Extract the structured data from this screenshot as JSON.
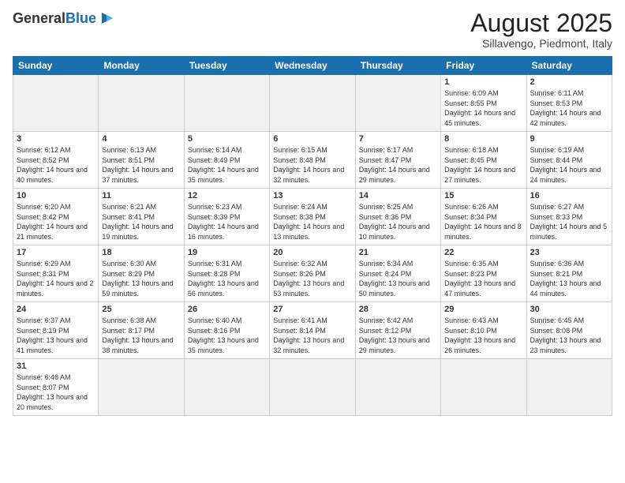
{
  "header": {
    "logo_general": "General",
    "logo_blue": "Blue",
    "title": "August 2025",
    "subtitle": "Sillavengo, Piedmont, Italy"
  },
  "days_of_week": [
    "Sunday",
    "Monday",
    "Tuesday",
    "Wednesday",
    "Thursday",
    "Friday",
    "Saturday"
  ],
  "weeks": [
    [
      {
        "day": "",
        "info": ""
      },
      {
        "day": "",
        "info": ""
      },
      {
        "day": "",
        "info": ""
      },
      {
        "day": "",
        "info": ""
      },
      {
        "day": "",
        "info": ""
      },
      {
        "day": "1",
        "info": "Sunrise: 6:09 AM\nSunset: 8:55 PM\nDaylight: 14 hours and 45 minutes."
      },
      {
        "day": "2",
        "info": "Sunrise: 6:11 AM\nSunset: 8:53 PM\nDaylight: 14 hours and 42 minutes."
      }
    ],
    [
      {
        "day": "3",
        "info": "Sunrise: 6:12 AM\nSunset: 8:52 PM\nDaylight: 14 hours and 40 minutes."
      },
      {
        "day": "4",
        "info": "Sunrise: 6:13 AM\nSunset: 8:51 PM\nDaylight: 14 hours and 37 minutes."
      },
      {
        "day": "5",
        "info": "Sunrise: 6:14 AM\nSunset: 8:49 PM\nDaylight: 14 hours and 35 minutes."
      },
      {
        "day": "6",
        "info": "Sunrise: 6:15 AM\nSunset: 8:48 PM\nDaylight: 14 hours and 32 minutes."
      },
      {
        "day": "7",
        "info": "Sunrise: 6:17 AM\nSunset: 8:47 PM\nDaylight: 14 hours and 29 minutes."
      },
      {
        "day": "8",
        "info": "Sunrise: 6:18 AM\nSunset: 8:45 PM\nDaylight: 14 hours and 27 minutes."
      },
      {
        "day": "9",
        "info": "Sunrise: 6:19 AM\nSunset: 8:44 PM\nDaylight: 14 hours and 24 minutes."
      }
    ],
    [
      {
        "day": "10",
        "info": "Sunrise: 6:20 AM\nSunset: 8:42 PM\nDaylight: 14 hours and 21 minutes."
      },
      {
        "day": "11",
        "info": "Sunrise: 6:21 AM\nSunset: 8:41 PM\nDaylight: 14 hours and 19 minutes."
      },
      {
        "day": "12",
        "info": "Sunrise: 6:23 AM\nSunset: 8:39 PM\nDaylight: 14 hours and 16 minutes."
      },
      {
        "day": "13",
        "info": "Sunrise: 6:24 AM\nSunset: 8:38 PM\nDaylight: 14 hours and 13 minutes."
      },
      {
        "day": "14",
        "info": "Sunrise: 6:25 AM\nSunset: 8:36 PM\nDaylight: 14 hours and 10 minutes."
      },
      {
        "day": "15",
        "info": "Sunrise: 6:26 AM\nSunset: 8:34 PM\nDaylight: 14 hours and 8 minutes."
      },
      {
        "day": "16",
        "info": "Sunrise: 6:27 AM\nSunset: 8:33 PM\nDaylight: 14 hours and 5 minutes."
      }
    ],
    [
      {
        "day": "17",
        "info": "Sunrise: 6:29 AM\nSunset: 8:31 PM\nDaylight: 14 hours and 2 minutes."
      },
      {
        "day": "18",
        "info": "Sunrise: 6:30 AM\nSunset: 8:29 PM\nDaylight: 13 hours and 59 minutes."
      },
      {
        "day": "19",
        "info": "Sunrise: 6:31 AM\nSunset: 8:28 PM\nDaylight: 13 hours and 56 minutes."
      },
      {
        "day": "20",
        "info": "Sunrise: 6:32 AM\nSunset: 8:26 PM\nDaylight: 13 hours and 53 minutes."
      },
      {
        "day": "21",
        "info": "Sunrise: 6:34 AM\nSunset: 8:24 PM\nDaylight: 13 hours and 50 minutes."
      },
      {
        "day": "22",
        "info": "Sunrise: 6:35 AM\nSunset: 8:23 PM\nDaylight: 13 hours and 47 minutes."
      },
      {
        "day": "23",
        "info": "Sunrise: 6:36 AM\nSunset: 8:21 PM\nDaylight: 13 hours and 44 minutes."
      }
    ],
    [
      {
        "day": "24",
        "info": "Sunrise: 6:37 AM\nSunset: 8:19 PM\nDaylight: 13 hours and 41 minutes."
      },
      {
        "day": "25",
        "info": "Sunrise: 6:38 AM\nSunset: 8:17 PM\nDaylight: 13 hours and 38 minutes."
      },
      {
        "day": "26",
        "info": "Sunrise: 6:40 AM\nSunset: 8:16 PM\nDaylight: 13 hours and 35 minutes."
      },
      {
        "day": "27",
        "info": "Sunrise: 6:41 AM\nSunset: 8:14 PM\nDaylight: 13 hours and 32 minutes."
      },
      {
        "day": "28",
        "info": "Sunrise: 6:42 AM\nSunset: 8:12 PM\nDaylight: 13 hours and 29 minutes."
      },
      {
        "day": "29",
        "info": "Sunrise: 6:43 AM\nSunset: 8:10 PM\nDaylight: 13 hours and 26 minutes."
      },
      {
        "day": "30",
        "info": "Sunrise: 6:45 AM\nSunset: 8:08 PM\nDaylight: 13 hours and 23 minutes."
      }
    ],
    [
      {
        "day": "31",
        "info": "Sunrise: 6:46 AM\nSunset: 8:07 PM\nDaylight: 13 hours and 20 minutes."
      },
      {
        "day": "",
        "info": ""
      },
      {
        "day": "",
        "info": ""
      },
      {
        "day": "",
        "info": ""
      },
      {
        "day": "",
        "info": ""
      },
      {
        "day": "",
        "info": ""
      },
      {
        "day": "",
        "info": ""
      }
    ]
  ]
}
